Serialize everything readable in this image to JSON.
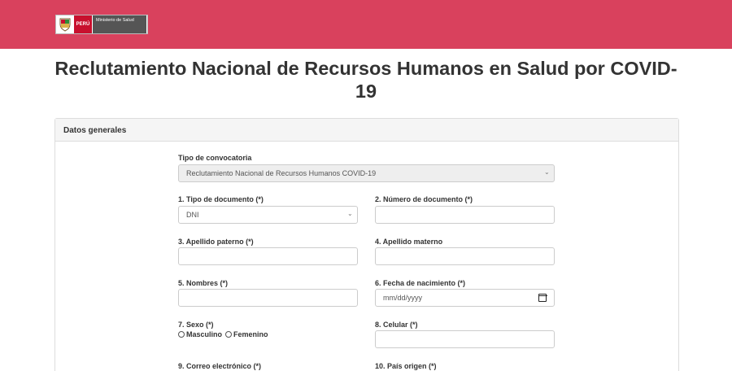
{
  "header": {
    "brand_peru": "PERÚ",
    "brand_ministry": "Ministerio de Salud",
    "brand_color": "#d9415d"
  },
  "page": {
    "title": "Reclutamiento Nacional de Recursos Humanos en Salud por COVID-19"
  },
  "panel": {
    "heading": "Datos generales"
  },
  "form": {
    "tipo_convocatoria": {
      "label": "Tipo de convocatoria",
      "value": "Reclutamiento Nacional de Recursos Humanos COVID-19"
    },
    "tipo_documento": {
      "label": "1. Tipo de documento (*)",
      "value": "DNI"
    },
    "numero_documento": {
      "label": "2. Número de documento (*)",
      "value": ""
    },
    "apellido_paterno": {
      "label": "3. Apellido paterno (*)",
      "value": ""
    },
    "apellido_materno": {
      "label": "4. Apellido materno",
      "value": ""
    },
    "nombres": {
      "label": "5. Nombres (*)",
      "value": ""
    },
    "fecha_nacimiento": {
      "label": "6. Fecha de nacimiento (*)",
      "placeholder": "mm/dd/yyyy"
    },
    "sexo": {
      "label": "7. Sexo (*)",
      "option_masculino": "Masculino",
      "option_femenino": "Femenino"
    },
    "celular": {
      "label": "8. Celular (*)",
      "value": ""
    },
    "correo": {
      "label": "9. Correo electrónico (*)"
    },
    "pais_origen": {
      "label": "10. País origen (*)"
    }
  }
}
